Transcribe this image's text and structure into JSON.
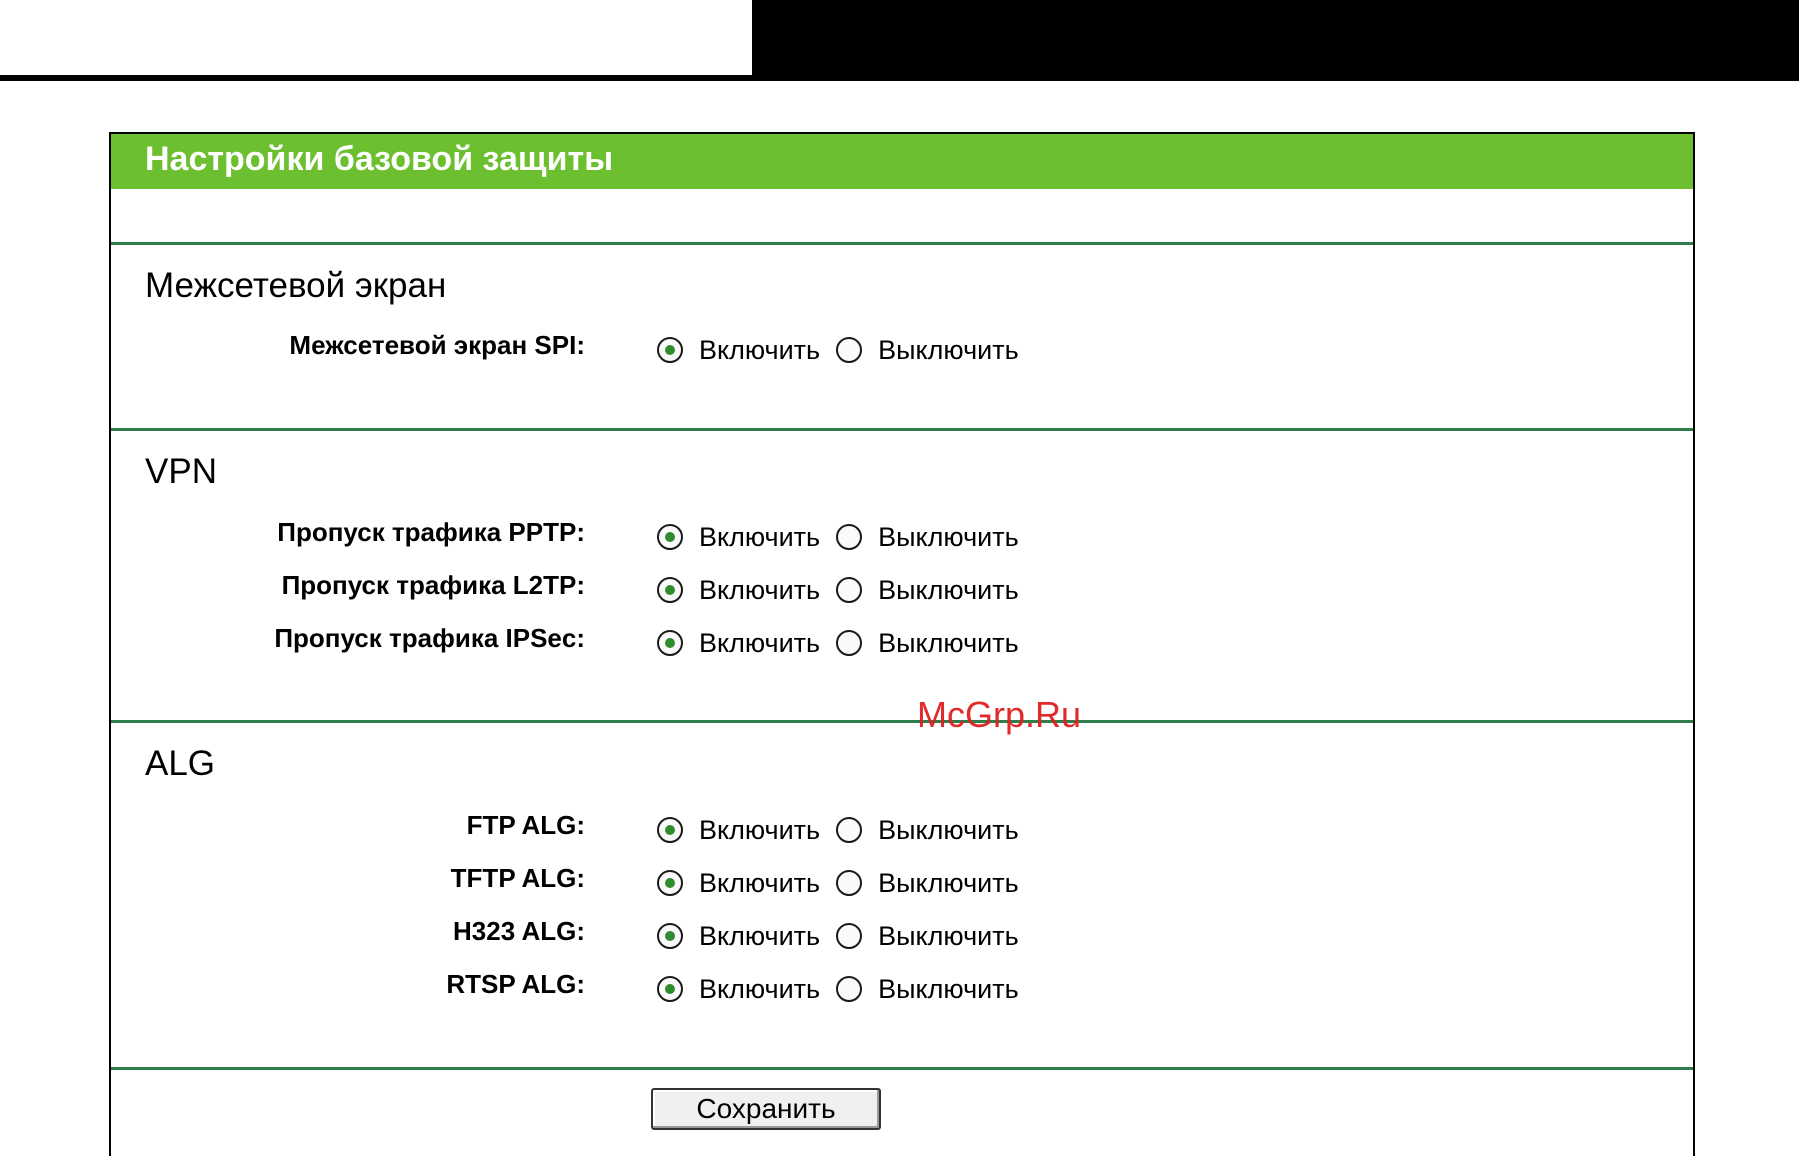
{
  "page": {
    "title": "Настройки базовой защиты"
  },
  "sections": [
    {
      "title": "Межсетевой экран",
      "rows": [
        {
          "label": "Межсетевой экран SPI:",
          "selected": "enable"
        }
      ]
    },
    {
      "title": "VPN",
      "rows": [
        {
          "label": "Пропуск трафика PPTP:",
          "selected": "enable"
        },
        {
          "label": "Пропуск трафика L2TP:",
          "selected": "enable"
        },
        {
          "label": "Пропуск трафика IPSec:",
          "selected": "enable"
        }
      ]
    },
    {
      "title": "ALG",
      "rows": [
        {
          "label": "FTP ALG:",
          "selected": "enable"
        },
        {
          "label": "TFTP ALG:",
          "selected": "enable"
        },
        {
          "label": "H323 ALG:",
          "selected": "enable"
        },
        {
          "label": "RTSP ALG:",
          "selected": "enable"
        }
      ]
    }
  ],
  "options": {
    "enable_label": "Включить",
    "disable_label": "Выключить"
  },
  "actions": {
    "save_label": "Сохранить"
  },
  "watermark": "McGrp.Ru",
  "colors": {
    "header_green": "#6cbf2e",
    "divider_green": "#2e7d4a",
    "radio_dot": "#2e8b2e",
    "watermark_red": "#e02020"
  }
}
